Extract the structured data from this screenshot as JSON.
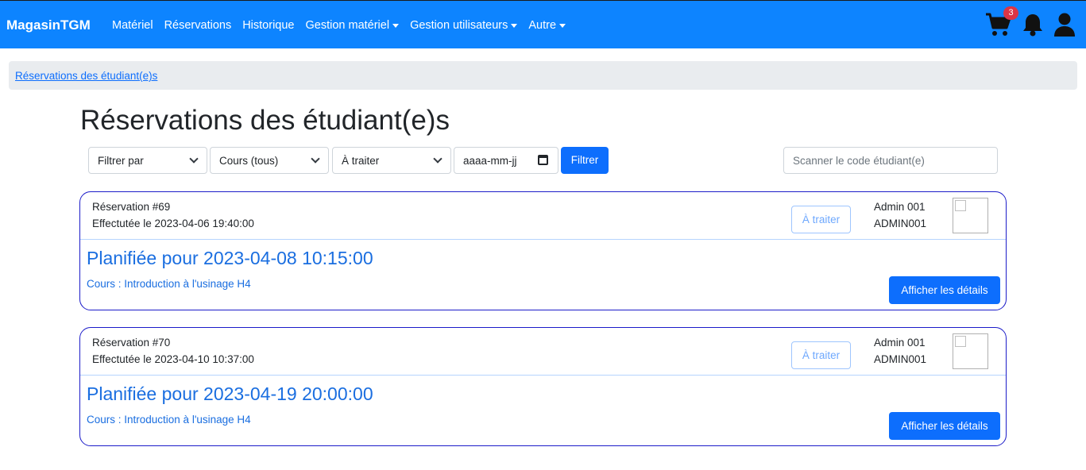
{
  "navbar": {
    "brand": "MagasinTGM",
    "items": [
      {
        "label": "Matériel",
        "dropdown": false
      },
      {
        "label": "Réservations",
        "dropdown": false
      },
      {
        "label": "Historique",
        "dropdown": false
      },
      {
        "label": "Gestion matériel",
        "dropdown": true
      },
      {
        "label": "Gestion utilisateurs",
        "dropdown": true
      },
      {
        "label": "Autre",
        "dropdown": true
      }
    ],
    "cart_count": "3",
    "icons": [
      "cart-icon",
      "bell-icon",
      "user-icon"
    ]
  },
  "breadcrumb": {
    "label": "Réservations des étudiant(e)s"
  },
  "page": {
    "title": "Réservations des étudiant(e)s"
  },
  "filters": {
    "filter_by": "Filtrer par",
    "course": "Cours (tous)",
    "status": "À traiter",
    "date_placeholder": "aaaa-mm-jj",
    "button": "Filtrer",
    "scan_placeholder": "Scanner le code étudiant(e)"
  },
  "reservations": [
    {
      "number": "Réservation #69",
      "made_on": "Effectutée le 2023-04-06 19:40:00",
      "status": "À traiter",
      "user_name": "Admin 001",
      "user_code": "ADMIN001",
      "planned": "Planifiée pour 2023-04-08 10:15:00",
      "course": "Cours : Introduction à l'usinage H4",
      "details_button": "Afficher les détails"
    },
    {
      "number": "Réservation #70",
      "made_on": "Effectutée le 2023-04-10 10:37:00",
      "status": "À traiter",
      "user_name": "Admin 001",
      "user_code": "ADMIN001",
      "planned": "Planifiée pour 2023-04-19 20:00:00",
      "course": "Cours : Introduction à l'usinage H4",
      "details_button": "Afficher les détails"
    }
  ],
  "colors": {
    "navbar": "#0d84ff",
    "primary": "#0d6efd",
    "badge": "#dc3545",
    "card_border": "#1c1cc9",
    "breadcrumb_bg": "#e9ecef"
  }
}
